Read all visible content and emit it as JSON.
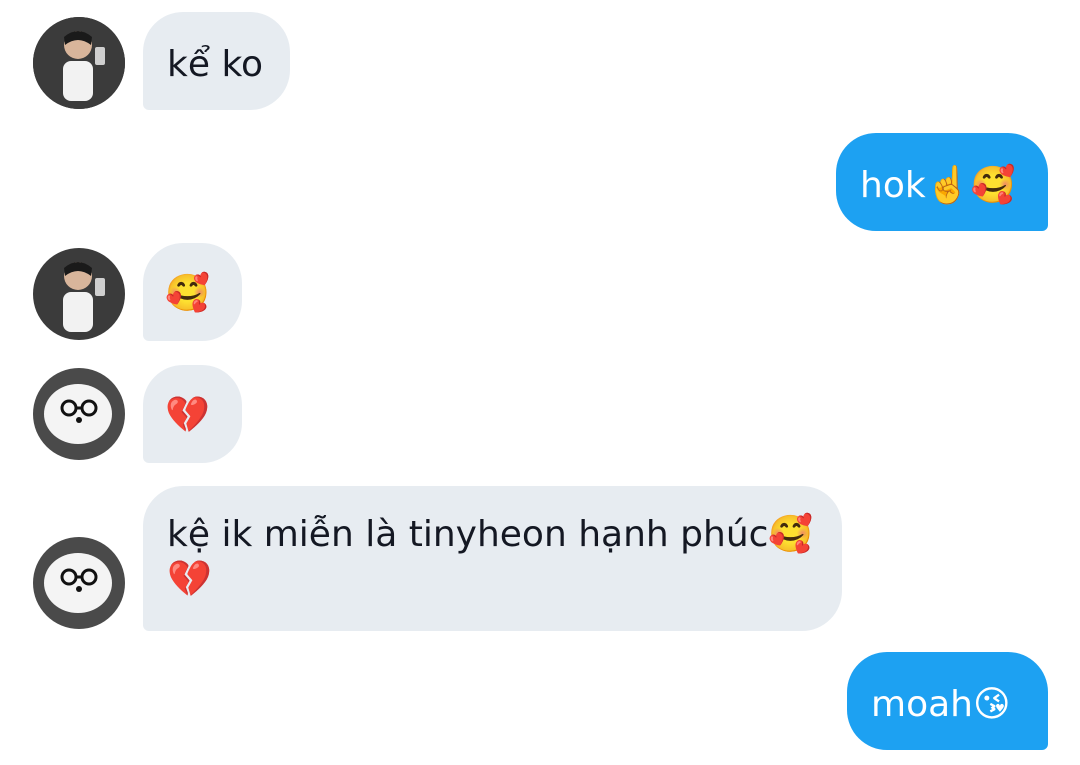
{
  "conversation": {
    "messages": [
      {
        "sender": "contact_a",
        "direction": "incoming",
        "text": "kể ko"
      },
      {
        "sender": "me",
        "direction": "outgoing",
        "text": "hok☝️🥰"
      },
      {
        "sender": "contact_a",
        "direction": "incoming",
        "text": "🥰"
      },
      {
        "sender": "contact_b",
        "direction": "incoming",
        "text": "💔"
      },
      {
        "sender": "contact_b",
        "direction": "incoming",
        "text": "kệ ik miễn là tinyheon hạnh phúc🥰 💔"
      },
      {
        "sender": "me",
        "direction": "outgoing",
        "text": "moah😘"
      }
    ]
  },
  "theme": {
    "incoming_bubble": "#e7ecf1",
    "outgoing_bubble": "#1da1f2",
    "incoming_text": "#141823",
    "outgoing_text": "#ffffff"
  }
}
